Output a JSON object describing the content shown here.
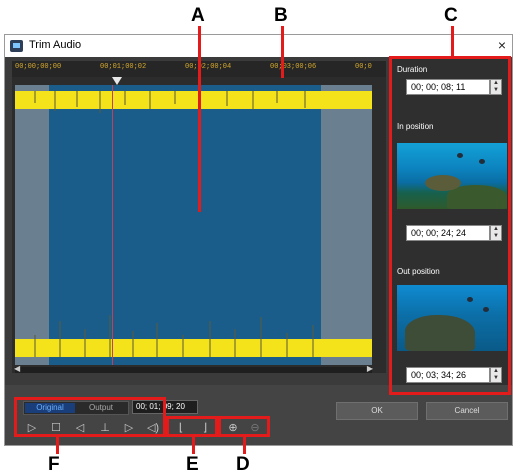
{
  "callouts": {
    "a": "A",
    "b": "B",
    "c": "C",
    "d": "D",
    "e": "E",
    "f": "F"
  },
  "window": {
    "title": "Trim Audio",
    "close_label": "×"
  },
  "ruler": {
    "ticks": [
      "00;00;00;00",
      "00;01;00;02",
      "00;02;00;04",
      "00;03;00;06",
      "00;0"
    ]
  },
  "panel": {
    "duration_label": "Duration",
    "duration_value": "00; 00; 08; 11",
    "in_label": "In position",
    "in_value": "00; 00; 24; 24",
    "out_label": "Out position",
    "out_value": "00; 03; 34; 26"
  },
  "playback": {
    "toggle_original": "Original",
    "toggle_output": "Output",
    "timecode": "00; 01; 09; 20",
    "play_icon": "▷",
    "stop_icon": "☐",
    "prev_frame_icon": "◁",
    "split_icon": "⊥",
    "next_frame_icon": "▷",
    "volume_icon": "◁)",
    "mark_in_icon": "⌊",
    "mark_out_icon": "⌋",
    "zoom_in_icon": "⊕",
    "zoom_out_icon": "⊖"
  },
  "buttons": {
    "ok": "OK",
    "cancel": "Cancel"
  }
}
